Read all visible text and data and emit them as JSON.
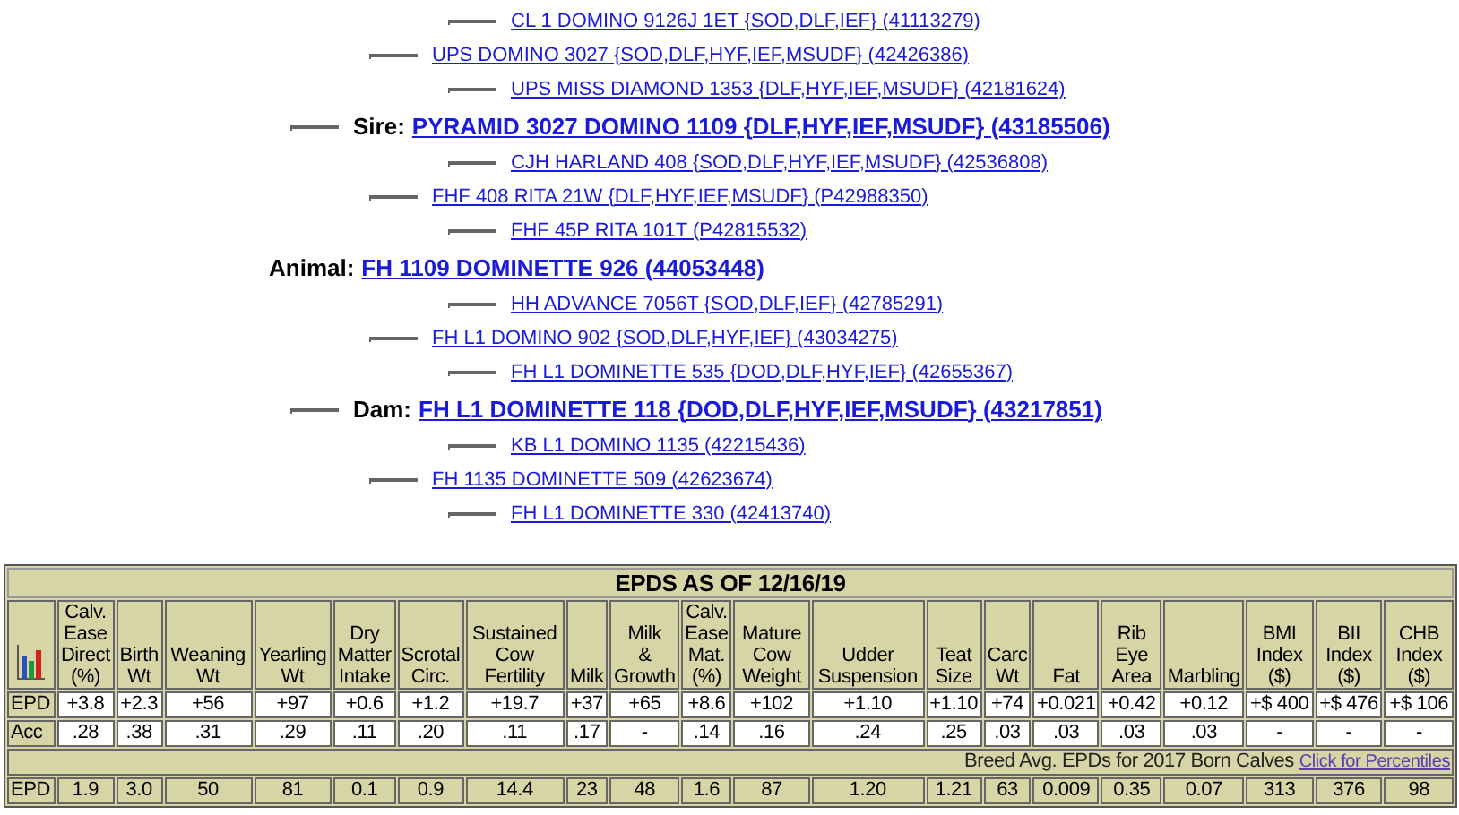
{
  "pedigree": {
    "label": "Animal:",
    "name": "FH 1109 DOMINETTE 926 (44053448)",
    "sire": {
      "label": "Sire:",
      "name": "PYRAMID 3027 DOMINO 1109 {DLF,HYF,IEF,MSUDF} (43185506)",
      "sire": {
        "name": "UPS DOMINO 3027 {SOD,DLF,HYF,IEF,MSUDF} (42426386)",
        "sire": {
          "name": "CL 1 DOMINO 9126J 1ET {SOD,DLF,IEF} (41113279)"
        },
        "dam": {
          "name": "UPS MISS DIAMOND 1353 {DLF,HYF,IEF,MSUDF} (42181624)"
        }
      },
      "dam": {
        "name": "FHF 408 RITA 21W {DLF,HYF,IEF,MSUDF} (P42988350)",
        "sire": {
          "name": "CJH HARLAND 408 {SOD,DLF,HYF,IEF,MSUDF} (42536808)"
        },
        "dam": {
          "name": "FHF 45P RITA 101T (P42815532)"
        }
      }
    },
    "dam": {
      "label": "Dam:",
      "name": "FH L1 DOMINETTE 118 {DOD,DLF,HYF,IEF,MSUDF} (43217851)",
      "sire": {
        "name": "FH L1 DOMINO 902 {SOD,DLF,HYF,IEF} (43034275)",
        "sire": {
          "name": "HH ADVANCE 7056T {SOD,DLF,IEF} (42785291)"
        },
        "dam": {
          "name": "FH L1 DOMINETTE 535 {DOD,DLF,HYF,IEF} (42655367)"
        }
      },
      "dam": {
        "name": "FH 1135 DOMINETTE 509 (42623674)",
        "sire": {
          "name": "KB L1 DOMINO 1135 (42215436)"
        },
        "dam": {
          "name": "FH L1 DOMINETTE 330 (42413740)"
        }
      }
    }
  },
  "epd_table": {
    "title": "EPDS AS OF 12/16/19",
    "columns": [
      "Calv.\nEase\nDirect\n(%)",
      "Birth\nWt",
      "Weaning\nWt",
      "Yearling\nWt",
      "Dry\nMatter\nIntake",
      "Scrotal\nCirc.",
      "Sustained\nCow\nFertility",
      "Milk",
      "Milk\n&\nGrowth",
      "Calv.\nEase\nMat.\n(%)",
      "Mature\nCow\nWeight",
      "Udder\nSuspension",
      "Teat\nSize",
      "Carc\nWt",
      "Fat",
      "Rib\nEye\nArea",
      "Marbling",
      "BMI\nIndex\n($)",
      "BII\nIndex\n($)",
      "CHB\nIndex\n($)"
    ],
    "rows": [
      {
        "label": "EPD",
        "values": [
          "+3.8",
          "+2.3",
          "+56",
          "+97",
          "+0.6",
          "+1.2",
          "+19.7",
          "+37",
          "+65",
          "+8.6",
          "+102",
          "+1.10",
          "+1.10",
          "+74",
          "+0.021",
          "+0.42",
          "+0.12",
          "+$ 400",
          "+$ 476",
          "+$ 106"
        ]
      },
      {
        "label": "Acc",
        "values": [
          ".28",
          ".38",
          ".31",
          ".29",
          ".11",
          ".20",
          ".11",
          ".17",
          "-",
          ".14",
          ".16",
          ".24",
          ".25",
          ".03",
          ".03",
          ".03",
          ".03",
          "-",
          "-",
          "-"
        ]
      }
    ],
    "breed_caption": "Breed Avg. EPDs for 2017 Born Calves",
    "breed_link": "Click for Percentiles",
    "breed_row": {
      "label": "EPD",
      "values": [
        "1.9",
        "3.0",
        "50",
        "81",
        "0.1",
        "0.9",
        "14.4",
        "23",
        "48",
        "1.6",
        "87",
        "1.20",
        "1.21",
        "63",
        "0.009",
        "0.35",
        "0.07",
        "313",
        "376",
        "98"
      ]
    }
  }
}
